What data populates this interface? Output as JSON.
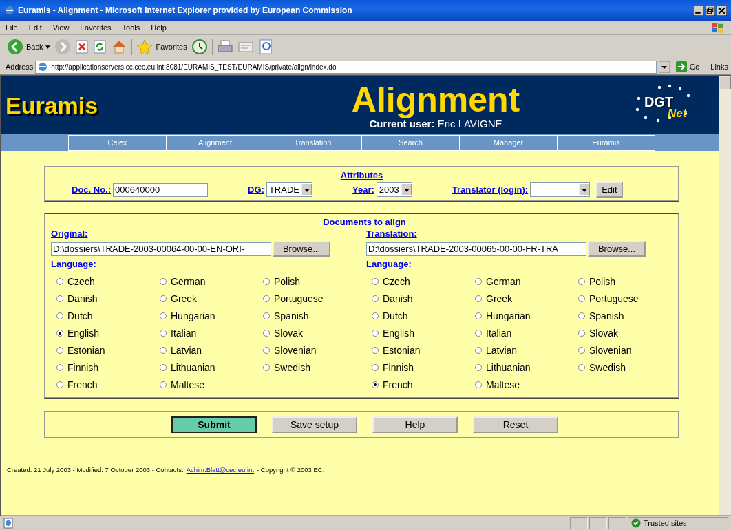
{
  "window": {
    "title": "Euramis - Alignment - Microsoft Internet Explorer provided by European Commission"
  },
  "menu": [
    "File",
    "Edit",
    "View",
    "Favorites",
    "Tools",
    "Help"
  ],
  "toolbar": {
    "back": "Back",
    "favorites": "Favorites"
  },
  "address": {
    "label": "Address",
    "url": "http://applicationservers.cc.cec.eu.int:8081/EURAMIS_TEST/EURAMIS/private/align/index.do",
    "go": "Go",
    "links": "Links"
  },
  "header": {
    "logo": "Euramis",
    "title": "Alignment",
    "user_label": "Current user:",
    "user": "Eric LAVIGNE",
    "dgt": "DGT",
    "net": "Net"
  },
  "nav": [
    "Celex",
    "Alignment",
    "Translation",
    "Search",
    "Manager",
    "Euramis"
  ],
  "attributes": {
    "title": "Attributes",
    "doc_label": "Doc. No.:",
    "doc_value": "000640000",
    "dg_label": "DG:",
    "dg_value": "TRADE",
    "year_label": "Year:",
    "year_value": "2003",
    "translator_label": "Translator (login):",
    "edit": "Edit"
  },
  "documents": {
    "title": "Documents to align",
    "sides": [
      {
        "label": "Original:",
        "path": "D:\\dossiers\\TRADE-2003-00064-00-00-EN-ORI-",
        "browse": "Browse...",
        "language_label": "Language:",
        "languages": [
          {
            "name": "Czech",
            "selected": false
          },
          {
            "name": "Danish",
            "selected": false
          },
          {
            "name": "Dutch",
            "selected": false
          },
          {
            "name": "English",
            "selected": true
          },
          {
            "name": "Estonian",
            "selected": false
          },
          {
            "name": "Finnish",
            "selected": false
          },
          {
            "name": "French",
            "selected": false
          },
          {
            "name": "German",
            "selected": false
          },
          {
            "name": "Greek",
            "selected": false
          },
          {
            "name": "Hungarian",
            "selected": false
          },
          {
            "name": "Italian",
            "selected": false
          },
          {
            "name": "Latvian",
            "selected": false
          },
          {
            "name": "Lithuanian",
            "selected": false
          },
          {
            "name": "Maltese",
            "selected": false
          },
          {
            "name": "Polish",
            "selected": false
          },
          {
            "name": "Portuguese",
            "selected": false
          },
          {
            "name": "Spanish",
            "selected": false
          },
          {
            "name": "Slovak",
            "selected": false
          },
          {
            "name": "Slovenian",
            "selected": false
          },
          {
            "name": "Swedish",
            "selected": false
          }
        ]
      },
      {
        "label": "Translation:",
        "path": "D:\\dossiers\\TRADE-2003-00065-00-00-FR-TRA",
        "browse": "Browse...",
        "language_label": "Language:",
        "languages": [
          {
            "name": "Czech",
            "selected": false
          },
          {
            "name": "Danish",
            "selected": false
          },
          {
            "name": "Dutch",
            "selected": false
          },
          {
            "name": "English",
            "selected": false
          },
          {
            "name": "Estonian",
            "selected": false
          },
          {
            "name": "Finnish",
            "selected": false
          },
          {
            "name": "French",
            "selected": true
          },
          {
            "name": "German",
            "selected": false
          },
          {
            "name": "Greek",
            "selected": false
          },
          {
            "name": "Hungarian",
            "selected": false
          },
          {
            "name": "Italian",
            "selected": false
          },
          {
            "name": "Latvian",
            "selected": false
          },
          {
            "name": "Lithuanian",
            "selected": false
          },
          {
            "name": "Maltese",
            "selected": false
          },
          {
            "name": "Polish",
            "selected": false
          },
          {
            "name": "Portuguese",
            "selected": false
          },
          {
            "name": "Spanish",
            "selected": false
          },
          {
            "name": "Slovak",
            "selected": false
          },
          {
            "name": "Slovenian",
            "selected": false
          },
          {
            "name": "Swedish",
            "selected": false
          }
        ]
      }
    ]
  },
  "buttons": [
    {
      "label": "Submit",
      "primary": true
    },
    {
      "label": "Save setup",
      "primary": false
    },
    {
      "label": "Help",
      "primary": false
    },
    {
      "label": "Reset",
      "primary": false
    }
  ],
  "footer": {
    "text_before": "Created: 21 July 2003 - Modified: 7 October 2003 - Contacts:",
    "email": "Achim.Blatt@cec.eu.int",
    "text_after": "- Copyright © 2003 EC."
  },
  "status_bar": {
    "zone": "Trusted sites"
  }
}
